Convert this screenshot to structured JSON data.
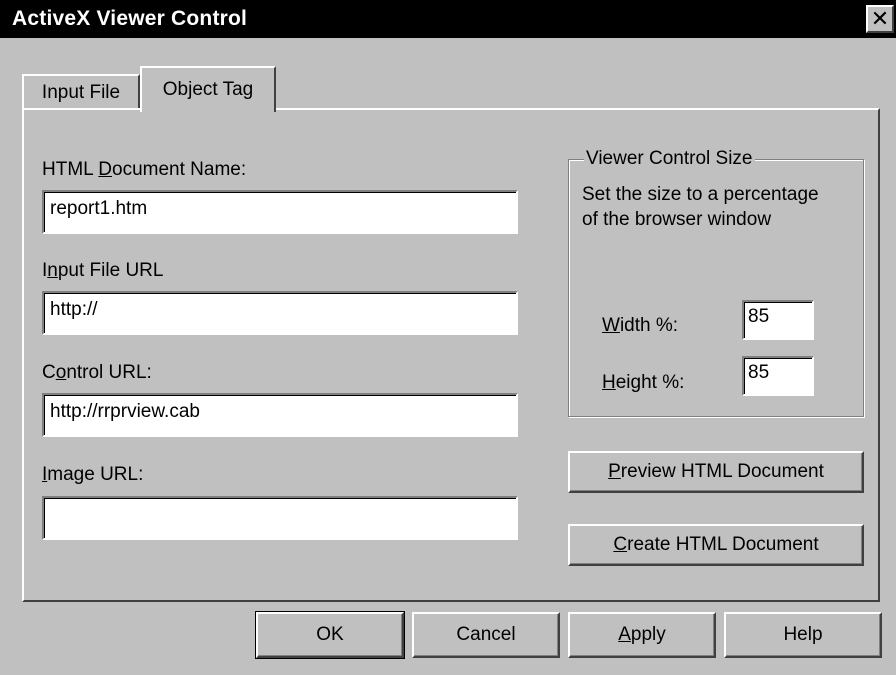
{
  "window": {
    "title": "ActiveX Viewer Control",
    "close_glyph": "✕"
  },
  "tabs": [
    {
      "label": "Input File",
      "active": false
    },
    {
      "label": "Object Tag",
      "active": true
    }
  ],
  "form": {
    "html_doc_label_pre": "HTML ",
    "html_doc_label_acc": "D",
    "html_doc_label_post": "ocument Name:",
    "html_doc_value": "report1.htm",
    "input_url_label_pre": "I",
    "input_url_label_acc": "n",
    "input_url_label_post": "put File URL",
    "input_url_value": "http://",
    "control_url_label_pre": "C",
    "control_url_label_acc": "o",
    "control_url_label_post": "ntrol URL:",
    "control_url_value": "http://rrprview.cab",
    "image_url_label_acc": "I",
    "image_url_label_post": "mage URL:",
    "image_url_value": ""
  },
  "size_group": {
    "legend": "Viewer Control Size",
    "desc_line1": "Set the size to a percentage",
    "desc_line2": "of the browser window",
    "width_label_acc": "W",
    "width_label_post": "idth %:",
    "width_value": "85",
    "height_label_acc": "H",
    "height_label_post": "eight %:",
    "height_value": "85"
  },
  "actions": {
    "preview_acc": "P",
    "preview_post": "review HTML Document",
    "create_acc": "C",
    "create_post": "reate HTML Document"
  },
  "footer": {
    "ok": "OK",
    "cancel": "Cancel",
    "apply_acc": "A",
    "apply_post": "pply",
    "help": "Help"
  }
}
